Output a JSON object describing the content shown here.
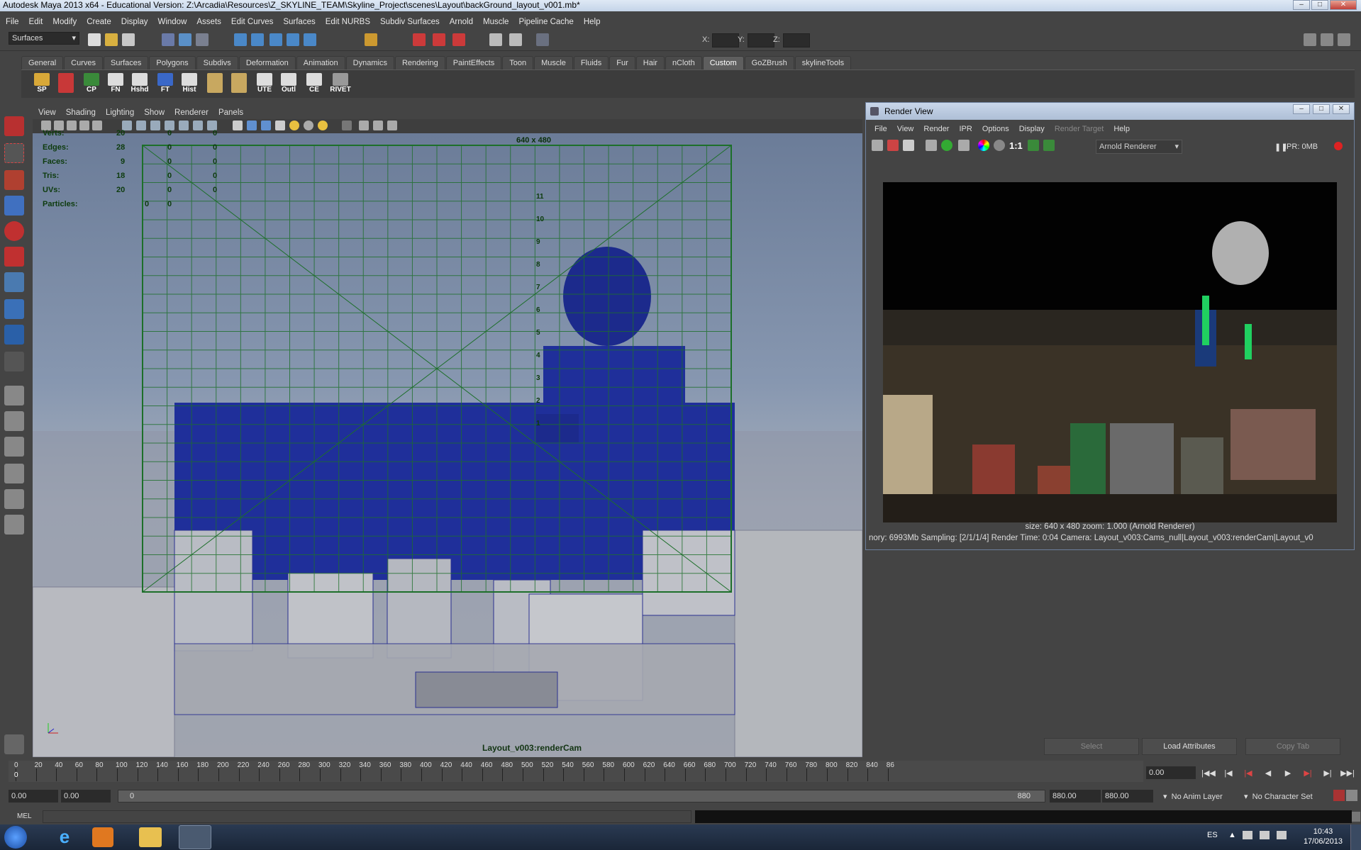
{
  "window": {
    "title": "Autodesk Maya 2013 x64 - Educational Version: Z:\\Arcadia\\Resources\\Z_SKYLINE_TEAM\\Skyline_Project\\scenes\\Layout\\backGround_layout_v001.mb*"
  },
  "menubar": [
    "File",
    "Edit",
    "Modify",
    "Create",
    "Display",
    "Window",
    "Assets",
    "Edit Curves",
    "Surfaces",
    "Edit NURBS",
    "Subdiv Surfaces",
    "Arnold",
    "Muscle",
    "Pipeline Cache",
    "Help"
  ],
  "status": {
    "mode": "Surfaces",
    "x_label": "X:",
    "y_label": "Y:",
    "z_label": "Z:"
  },
  "shelf_tabs": [
    "General",
    "Curves",
    "Surfaces",
    "Polygons",
    "Subdivs",
    "Deformation",
    "Animation",
    "Dynamics",
    "Rendering",
    "PaintEffects",
    "Toon",
    "Muscle",
    "Fluids",
    "Fur",
    "Hair",
    "nCloth",
    "Custom",
    "GoZBrush",
    "skylineTools"
  ],
  "shelf_active": "Custom",
  "shelf_buttons": [
    "SP",
    "",
    "CP",
    "FN",
    "Hshd",
    "FT",
    "Hist",
    "",
    "",
    "UTE",
    "Outl",
    "CE",
    "RIVET"
  ],
  "viewport": {
    "menu": [
      "View",
      "Shading",
      "Lighting",
      "Show",
      "Renderer",
      "Panels"
    ],
    "resolution": "640 x 480",
    "camera": "Layout_v003:renderCam",
    "hud": [
      {
        "label": "Verts:",
        "a": "20",
        "b": "0",
        "c": "0"
      },
      {
        "label": "Edges:",
        "a": "28",
        "b": "0",
        "c": "0"
      },
      {
        "label": "Faces:",
        "a": "9",
        "b": "0",
        "c": "0"
      },
      {
        "label": "Tris:",
        "a": "18",
        "b": "0",
        "c": "0"
      },
      {
        "label": "UVs:",
        "a": "20",
        "b": "0",
        "c": "0"
      },
      {
        "label": "Particles:",
        "a": "0",
        "b": "0",
        "c": ""
      }
    ],
    "grid_numbers": [
      "11",
      "10",
      "9",
      "8",
      "7",
      "6",
      "5",
      "4",
      "3",
      "2",
      "1"
    ]
  },
  "render_view": {
    "title": "Render View",
    "menu": [
      "File",
      "View",
      "Render",
      "IPR",
      "Options",
      "Display",
      "Render Target",
      "Help"
    ],
    "ratio": "1:1",
    "renderer": "Arnold Renderer",
    "ipr": "IPR: 0MB",
    "info1": "size: 640 x 480 zoom: 1.000     (Arnold Renderer)",
    "info2": "nory: 6993Mb    Sampling: [2/1/1/4]    Render Time: 0:04    Camera: Layout_v003:Cams_null|Layout_v003:renderCam|Layout_v0"
  },
  "attr_buttons": [
    "Select",
    "Load Attributes",
    "Copy Tab"
  ],
  "timeline": {
    "ticks": [
      "0",
      "20",
      "40",
      "60",
      "80",
      "100",
      "120",
      "140",
      "160",
      "180",
      "200",
      "220",
      "240",
      "260",
      "280",
      "300",
      "320",
      "340",
      "360",
      "380",
      "400",
      "420",
      "440",
      "460",
      "480",
      "500",
      "520",
      "540",
      "560",
      "580",
      "600",
      "620",
      "640",
      "660",
      "680",
      "700",
      "720",
      "740",
      "760",
      "780",
      "800",
      "820",
      "840",
      "86"
    ],
    "start_marker": "0",
    "current_frame": "0.00"
  },
  "range": {
    "start": "0.00",
    "inner_start": "0.00",
    "slider_start": "0",
    "slider_end": "880",
    "inner_end": "880.00",
    "end": "880.00",
    "anim_layer": "No Anim Layer",
    "char_set": "No Character Set"
  },
  "cmd": {
    "label": "MEL"
  },
  "taskbar": {
    "lang": "ES",
    "time": "10:43",
    "date": "17/06/2013"
  }
}
